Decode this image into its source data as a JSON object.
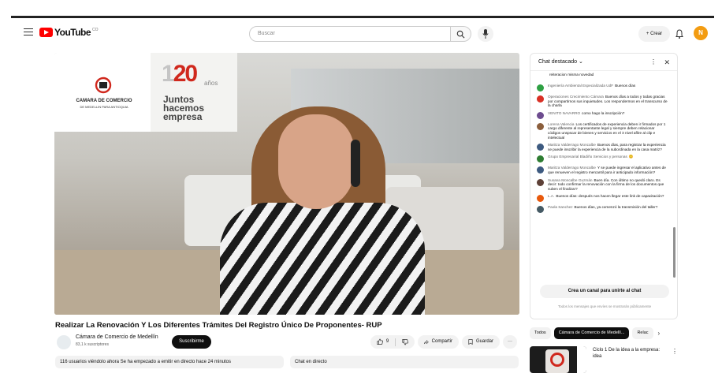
{
  "header": {
    "logo_text": "YouTube",
    "country_code": "CO",
    "search_placeholder": "Buscar",
    "create_label": "+ Crear",
    "avatar_letter": "N"
  },
  "video_overlay": {
    "org_name": "CAMARA DE COMERCIO",
    "org_sub": "DE MEDELLIN PARA ANTIOQUIA",
    "anniv_prefix": "1",
    "anniv_main": "20",
    "anniv_suffix": "años",
    "slogan_1": "Juntos",
    "slogan_2": "hacemos",
    "slogan_3": "empresa"
  },
  "video": {
    "title": "Realizar La Renovación Y Los Diferentes Trámites Del Registro Único De Proponentes- RUP",
    "channel_name": "Cámara de Comercio de Medellín",
    "channel_subs": "83,1 k suscriptores",
    "subscribe_label": "Suscribirme",
    "likes": "9",
    "share_label": "Compartir",
    "save_label": "Guardar",
    "more_label": "···",
    "description_stats": "116 usuarios viéndolo ahora  Se ha empezado a emitir en directo hace 24 minutos",
    "live_chat_label": "Chat en directo"
  },
  "chat": {
    "header_title": "Chat destacado ⌄",
    "messages": [
      {
        "author": "",
        "text": "reiteracion misma novedad",
        "color": "#ffffff"
      },
      {
        "author": "Ingeniería Ambiental Especializada UdF",
        "text": "Buenos días",
        "color": "#2ea043"
      },
      {
        "author": "Operaciones Crecimiento Cámara",
        "text": "Buenos días a todos y todas gracias por compartirnos sus inquietudes. Los respondermos en el transcurso de la charla",
        "color": "#d93025"
      },
      {
        "author": "VENITO NAVARRO",
        "text": "como hago la inscripción?",
        "color": "#6d4c8f"
      },
      {
        "author": "Lorena Valencia",
        "text": "Los certificados de experiencia deben ir firmados por 1 cargo diferente al representante legal y siempre deben relacionar códigos unspscar de bienes y servicios en el 3 nivel aflire al clip e intelectual",
        "color": "#8b5e3c"
      },
      {
        "author": "Maritza Valderrago Moncalbe",
        "text": "Buenos días, para registrar la experiencia se puede inscribir la experiencia de la subordinada en la casa matriz?",
        "color": "#3d5a80"
      },
      {
        "author": "Grupo Empresarial Bladiño Servicios y personas",
        "text": "😊",
        "color": "#2e7d32"
      },
      {
        "author": "Maritza Valderrago Moncalbe",
        "text": "Y se puede ingresar el aplicativo antes de que renueven el registro mercantil para ir anticipado información?",
        "color": "#3d5a80"
      },
      {
        "author": "Susana Moncalbe Guzmán",
        "text": "Buen día. Con último no quedó claro. Es decir: todo confirmar la renovación con la firma de los documentos que suben el finalizar?",
        "color": "#5d4037"
      },
      {
        "author": "L.A.",
        "text": "Buenos días: después nos hacen llegar este link de capacitación?",
        "color": "#e8590c"
      },
      {
        "author": "Paola Sanchez",
        "text": "Buenos días, ya comenzó la transmisión del taller?",
        "color": "#455a64"
      }
    ],
    "join_label": "Crea un canal para unirte al chat",
    "footer_text": "Todos los mensajes que envíes se mostrarán públicamente"
  },
  "related": {
    "chips": [
      "Todos",
      "Cámara de Comercio de Medellí...",
      "Relac"
    ],
    "active_chip": 1,
    "rec_title": "Ciclo 1 De la idea a la empresa: idea"
  }
}
